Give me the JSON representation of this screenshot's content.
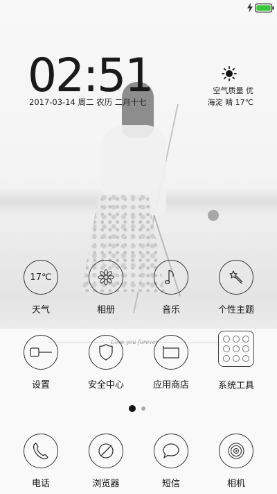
{
  "lock_screen": {
    "time": {
      "hour": "02",
      "sep": ":",
      "minute": "51"
    },
    "date": "2017-03-14 周二 农历 二月十七",
    "weather": {
      "icon": "sun-icon",
      "air_quality": "空气质量 优",
      "location_condition_temp": "海淀 晴 17℃"
    },
    "wallpaper_text": "Love you forever"
  },
  "status_bar": {
    "charging_icon": "lightning-icon",
    "battery_icon": "battery-full-icon",
    "battery_color": "#3cc63c"
  },
  "apps": {
    "row1": [
      {
        "label": "天气",
        "icon_text": "17℃",
        "icon": "weather-temp-icon"
      },
      {
        "label": "相册",
        "icon": "flower-icon"
      },
      {
        "label": "音乐",
        "icon": "music-note-icon"
      },
      {
        "label": "个性主题",
        "icon": "magic-wand-icon"
      }
    ],
    "row2": [
      {
        "label": "设置",
        "icon": "settings-toggle-icon"
      },
      {
        "label": "安全中心",
        "icon": "shield-icon"
      },
      {
        "label": "应用商店",
        "icon": "shopping-bag-icon"
      },
      {
        "label": "系统工具",
        "icon": "tools-folder-icon"
      }
    ],
    "dock": [
      {
        "label": "电话",
        "icon": "phone-icon"
      },
      {
        "label": "浏览器",
        "icon": "browser-icon"
      },
      {
        "label": "短信",
        "icon": "message-icon"
      },
      {
        "label": "相机",
        "icon": "camera-icon"
      }
    ]
  },
  "page_indicator": {
    "pages": 2,
    "current": 1
  }
}
